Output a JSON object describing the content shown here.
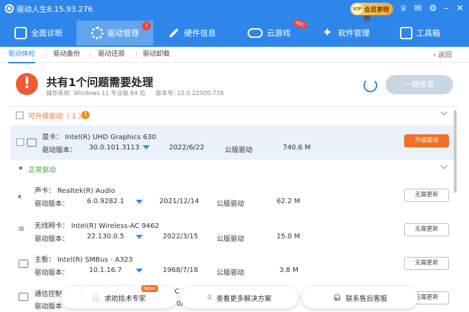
{
  "app": {
    "title": "驱动人生8.15.93.276",
    "vip_label": "会员享特权",
    "vip_tag": "VIP"
  },
  "nav": {
    "items": [
      {
        "label": "全面诊断",
        "icon": "monitor-icon"
      },
      {
        "label": "驱动管理",
        "icon": "gear-icon",
        "badge": "!"
      },
      {
        "label": "硬件信息",
        "icon": "wrench-icon"
      },
      {
        "label": "云游戏",
        "icon": "gamepad-icon",
        "tag": "HOT"
      },
      {
        "label": "软件管理",
        "icon": "apps-icon"
      },
      {
        "label": "工具箱",
        "icon": "toolbox-icon"
      }
    ]
  },
  "subnav": {
    "items": [
      "驱动体检",
      "驱动备份",
      "驱动还原",
      "驱动卸载"
    ],
    "back": "返回"
  },
  "summary": {
    "title": "共有1个问题需要处理",
    "os_label": "操作系统: Windows 11 专业版 64 位",
    "version_label": "版本号: 10.0.22000.739",
    "fix_button": "一键修复"
  },
  "upgradable": {
    "title": "可升级驱动（ 1 ）",
    "badge": "!",
    "devices": [
      {
        "type": "显卡：",
        "name": "Intel(R) UHD Graphics 630",
        "version_label": "驱动版本：",
        "version": "30.0.101.3113",
        "date": "2022/6/22",
        "kind": "公版驱动",
        "size": "740.6 M",
        "button": "升级驱动"
      }
    ]
  },
  "normal": {
    "title": "正常驱动",
    "devices": [
      {
        "type": "声卡：",
        "name": "Realtek(R) Audio",
        "version_label": "驱动版本：",
        "version": "6.0.9282.1",
        "date": "2021/12/14",
        "kind": "公版驱动",
        "size": "62.2 M",
        "button": "无需更新"
      },
      {
        "type": "无线网卡：",
        "name": "Intel(R) Wireless-AC 9462",
        "version_label": "驱动版本：",
        "version": "22.130.0.5",
        "date": "2022/3/15",
        "kind": "公版驱动",
        "size": "15.0 M",
        "button": "无需更新"
      },
      {
        "type": "主板：",
        "name": "Intel(R) SMBus - A323",
        "version_label": "驱动版本：",
        "version": "10.1.16.7",
        "date": "1968/7/18",
        "kind": "公版驱动",
        "size": "3.8 M",
        "button": "无需更新"
      },
      {
        "type": "通信控制",
        "name": "t C",
        "version_label": "驱动版本",
        "version": "",
        "date": "0/",
        "kind": "",
        "size": "",
        "button": "无需更新"
      }
    ]
  },
  "bottom": {
    "expert": "求助技术专家",
    "new_tag": "New!",
    "solutions": "查看更多解决方案",
    "support": "联系售后客服"
  },
  "colors": {
    "primary": "#2f86ea",
    "warning": "#f05a30",
    "upgrade": "#f27026"
  }
}
